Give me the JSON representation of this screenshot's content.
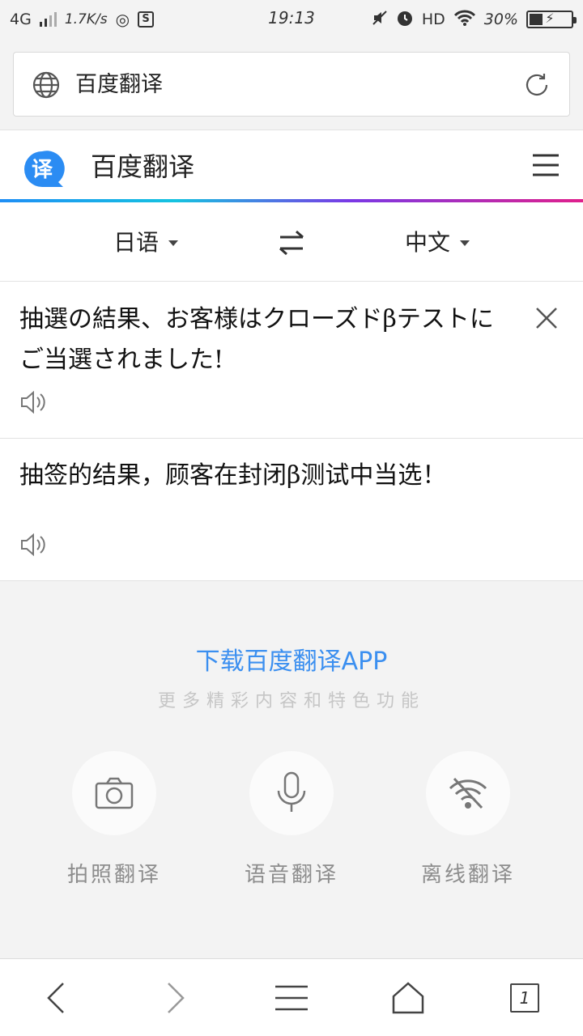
{
  "status_bar": {
    "network": "4G",
    "speed": "1.7K/s",
    "time": "19:13",
    "hd": "HD",
    "battery_percent": "30%",
    "battery_level": 0.3
  },
  "address_bar": {
    "title": "百度翻译"
  },
  "site_header": {
    "logo_text": "译",
    "title": "百度翻译"
  },
  "language": {
    "source": "日语",
    "target": "中文"
  },
  "source": {
    "text": "抽選の結果、お客様はクローズドβテストにご当選されました!"
  },
  "result": {
    "text": "抽签的结果，顾客在封闭β测试中当选！"
  },
  "promo": {
    "title": "下载百度翻译APP",
    "subtitle": "更多精彩内容和特色功能"
  },
  "features": [
    {
      "label": "拍照翻译",
      "icon": "camera-icon"
    },
    {
      "label": "语音翻译",
      "icon": "microphone-icon"
    },
    {
      "label": "离线翻译",
      "icon": "wifi-off-icon"
    }
  ],
  "bottom_nav": {
    "tab_count": "1"
  },
  "colors": {
    "accent": "#3b8ff0",
    "logo_blue": "#2b8cf3"
  }
}
